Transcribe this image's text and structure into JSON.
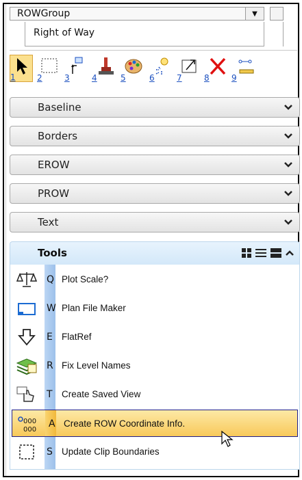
{
  "header": {
    "group_select_value": "ROWGroup",
    "tab_label": "Right of Way"
  },
  "toolbar": {
    "tools": [
      {
        "num": "1",
        "icon": "select-arrow-icon",
        "active": true
      },
      {
        "num": "2",
        "icon": "fence-icon"
      },
      {
        "num": "3",
        "icon": "move-element-icon"
      },
      {
        "num": "4",
        "icon": "brush-icon"
      },
      {
        "num": "5",
        "icon": "palette-icon"
      },
      {
        "num": "6",
        "icon": "bulb-icon"
      },
      {
        "num": "7",
        "icon": "scale-box-icon"
      },
      {
        "num": "8",
        "icon": "delete-x-icon"
      },
      {
        "num": "9",
        "icon": "measure-icon"
      }
    ]
  },
  "panels": [
    {
      "label": "Baseline"
    },
    {
      "label": "Borders"
    },
    {
      "label": "EROW"
    },
    {
      "label": "PROW"
    },
    {
      "label": "Text"
    }
  ],
  "tools_panel": {
    "label": "Tools",
    "items": [
      {
        "key": "Q",
        "label": "Plot Scale?",
        "icon": "scale-balance-icon"
      },
      {
        "key": "W",
        "label": "Plan File Maker",
        "icon": "window-icon"
      },
      {
        "key": "E",
        "label": "FlatRef",
        "icon": "down-arrow-icon"
      },
      {
        "key": "R",
        "label": "Fix Level Names",
        "icon": "layers-icon"
      },
      {
        "key": "T",
        "label": "Create Saved View",
        "icon": "hand-view-icon"
      },
      {
        "key": "A",
        "label": "Create ROW Coordinate Info.",
        "icon": "coordinates-icon",
        "highlighted": true
      },
      {
        "key": "S",
        "label": "Update Clip Boundaries",
        "icon": "clip-boundary-icon"
      }
    ]
  }
}
